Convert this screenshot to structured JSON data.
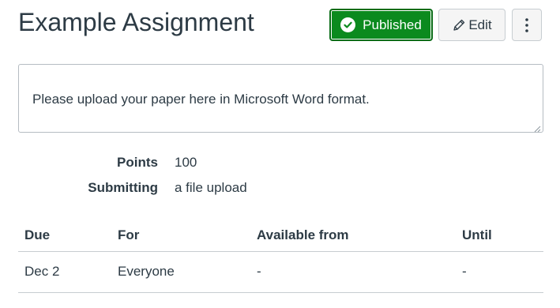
{
  "assignment": {
    "title": "Example Assignment"
  },
  "toolbar": {
    "published_label": "Published",
    "edit_label": "Edit"
  },
  "description": {
    "text": "Please upload your paper here in Microsoft Word format."
  },
  "details": {
    "points_label": "Points",
    "points_value": "100",
    "submitting_label": "Submitting",
    "submitting_value": "a file upload"
  },
  "due_table": {
    "headers": [
      "Due",
      "For",
      "Available from",
      "Until"
    ],
    "rows": [
      [
        "Dec 2",
        "Everyone",
        "-",
        "-"
      ]
    ]
  },
  "colors": {
    "published_green": "#0b8a1e",
    "text": "#2d3b45",
    "button_gray": "#f5f5f5",
    "border": "#c7cdd1"
  },
  "icons": {
    "published": "check-circle-icon",
    "edit": "pencil-icon",
    "more": "kebab-menu-icon"
  }
}
